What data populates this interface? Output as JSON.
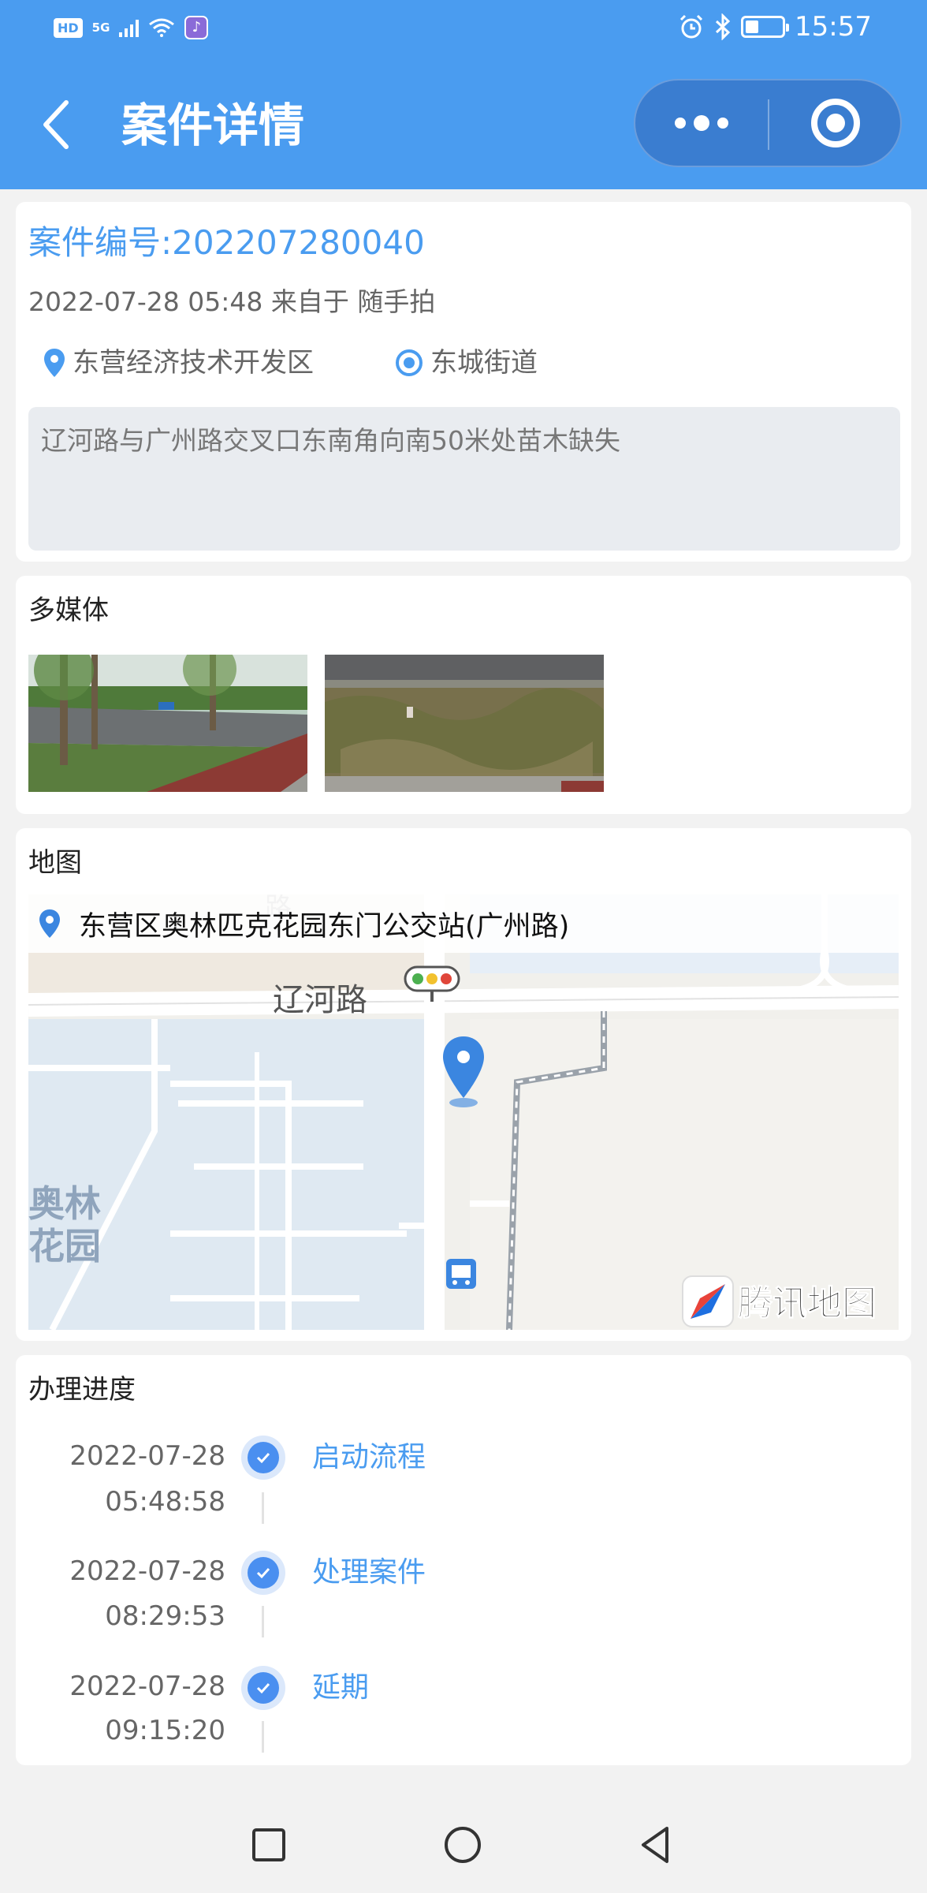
{
  "status_bar": {
    "left_badges": {
      "hd": "HD",
      "network": "5G"
    },
    "time": "15:57",
    "icons": [
      "alarm-icon",
      "bluetooth-icon",
      "battery-icon"
    ]
  },
  "header": {
    "title": "案件详情",
    "back_icon": "chevron-left-icon",
    "more_icon": "more-dots-icon",
    "close_icon": "target-close-icon"
  },
  "case": {
    "number_label": "案件编号:202207280040",
    "meta": "2022-07-28 05:48 来自于 随手拍",
    "district": "东营经济技术开发区",
    "street": "东城街道",
    "description": "辽河路与广州路交叉口东南角向南50米处苗木缺失"
  },
  "media": {
    "title": "多媒体",
    "images": [
      {
        "alt": "道路与人行道照片"
      },
      {
        "alt": "绿化带缺失照片"
      }
    ]
  },
  "map": {
    "title": "地图",
    "address": "东营区奥林匹克花园东门公交站(广州路)",
    "road_label": "辽河路",
    "road_label_top": "路",
    "area_label_1": "奥林",
    "area_label_2": "花园",
    "brand": "腾讯地图"
  },
  "progress": {
    "title": "办理进度",
    "steps": [
      {
        "date": "2022-07-28",
        "time": "05:48:58",
        "label": "启动流程"
      },
      {
        "date": "2022-07-28",
        "time": "08:29:53",
        "label": "处理案件"
      },
      {
        "date": "2022-07-28",
        "time": "09:15:20",
        "label": "延期"
      }
    ]
  },
  "colors": {
    "accent": "#4a9cf0",
    "header_bg": "#4a9cf0",
    "page_bg": "#f2f2f2"
  }
}
